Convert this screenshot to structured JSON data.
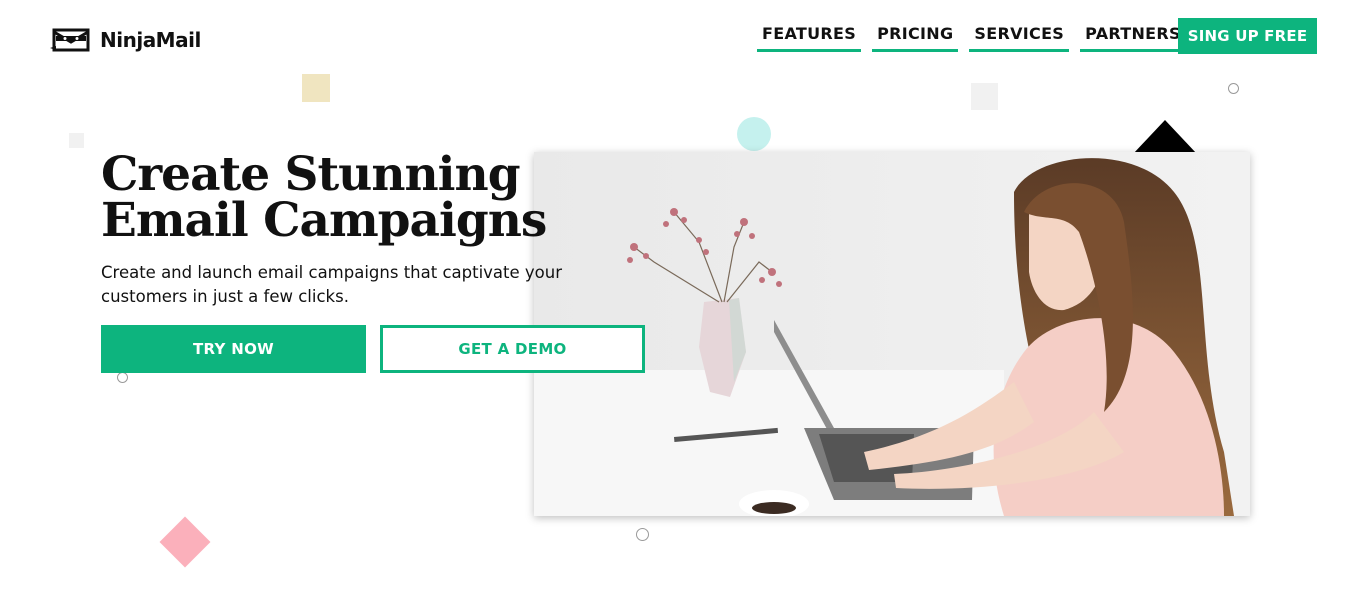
{
  "brand": {
    "name": "NinjaMail",
    "logo_icon": "ninja-envelope-icon"
  },
  "nav": {
    "items": [
      {
        "label": "FEATURES"
      },
      {
        "label": "PRICING"
      },
      {
        "label": "SERVICES"
      },
      {
        "label": "PARTNERS"
      }
    ],
    "cta_label": "SING UP FREE"
  },
  "hero": {
    "headline": "Create Stunning Email Campaigns",
    "subtext": "Create and launch email campaigns that captivate your customers in just a few clicks.",
    "primary_button": "TRY NOW",
    "secondary_button": "GET A DEMO",
    "image": "woman-typing-on-laptop-photo"
  },
  "colors": {
    "accent": "#0db47e",
    "text": "#111111",
    "deco_yellow": "#f0e5c0",
    "deco_cyan": "#c5f1ee",
    "deco_pink": "#fbb0bb"
  }
}
